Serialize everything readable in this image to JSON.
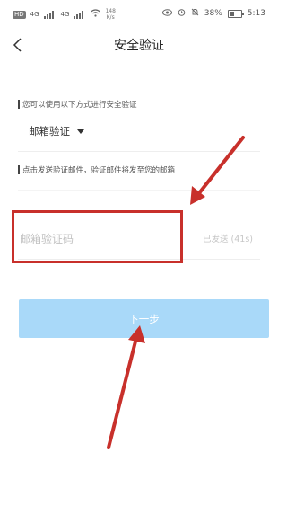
{
  "status_bar": {
    "network_badge": "HD",
    "signal_1": "4G",
    "signal_2": "4G",
    "speed_value": "148",
    "speed_unit": "K/s",
    "battery": "38%",
    "time": "5:13"
  },
  "header": {
    "title": "安全验证"
  },
  "verify": {
    "instruction": "您可以使用以下方式进行安全验证",
    "method": "邮箱验证",
    "send_instruction": "点击发送验证邮件，验证邮件将发至您的邮箱",
    "code_placeholder": "邮箱验证码",
    "code_value": "",
    "resend_label": "已发送 (41s)"
  },
  "next_button": {
    "label": "下一步"
  },
  "colors": {
    "accent_button": "#a9d9f9",
    "annotation": "#c8302b"
  }
}
